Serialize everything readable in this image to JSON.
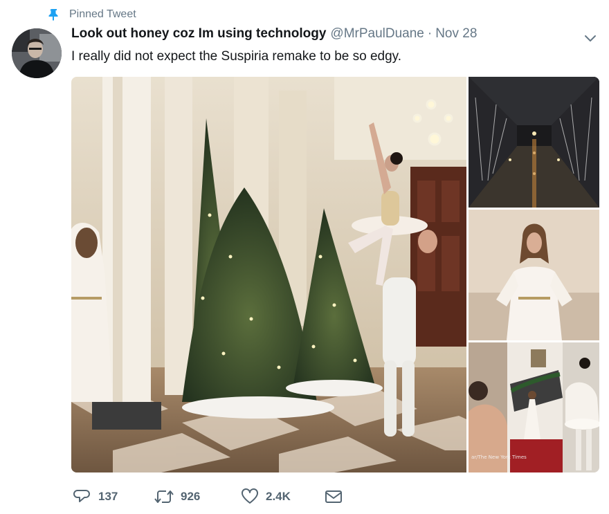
{
  "pinned": {
    "label": "Pinned Tweet",
    "icon": "pin-icon"
  },
  "author": {
    "display_name": "Look out honey coz Im using technology",
    "handle": "@MrPaulDuane",
    "separator": "·",
    "date": "Nov 28",
    "avatar": "avatar"
  },
  "tweet": {
    "text": "I really did not expect the Suspiria remake to be so edgy."
  },
  "media": {
    "credit": "ar/The New York Times"
  },
  "actions": {
    "reply_count": "137",
    "retweet_count": "926",
    "like_count": "2.4K"
  },
  "colors": {
    "text_primary": "#14171a",
    "text_secondary": "#657786",
    "accent": "#1da1f2",
    "icon_gray": "#536471"
  }
}
